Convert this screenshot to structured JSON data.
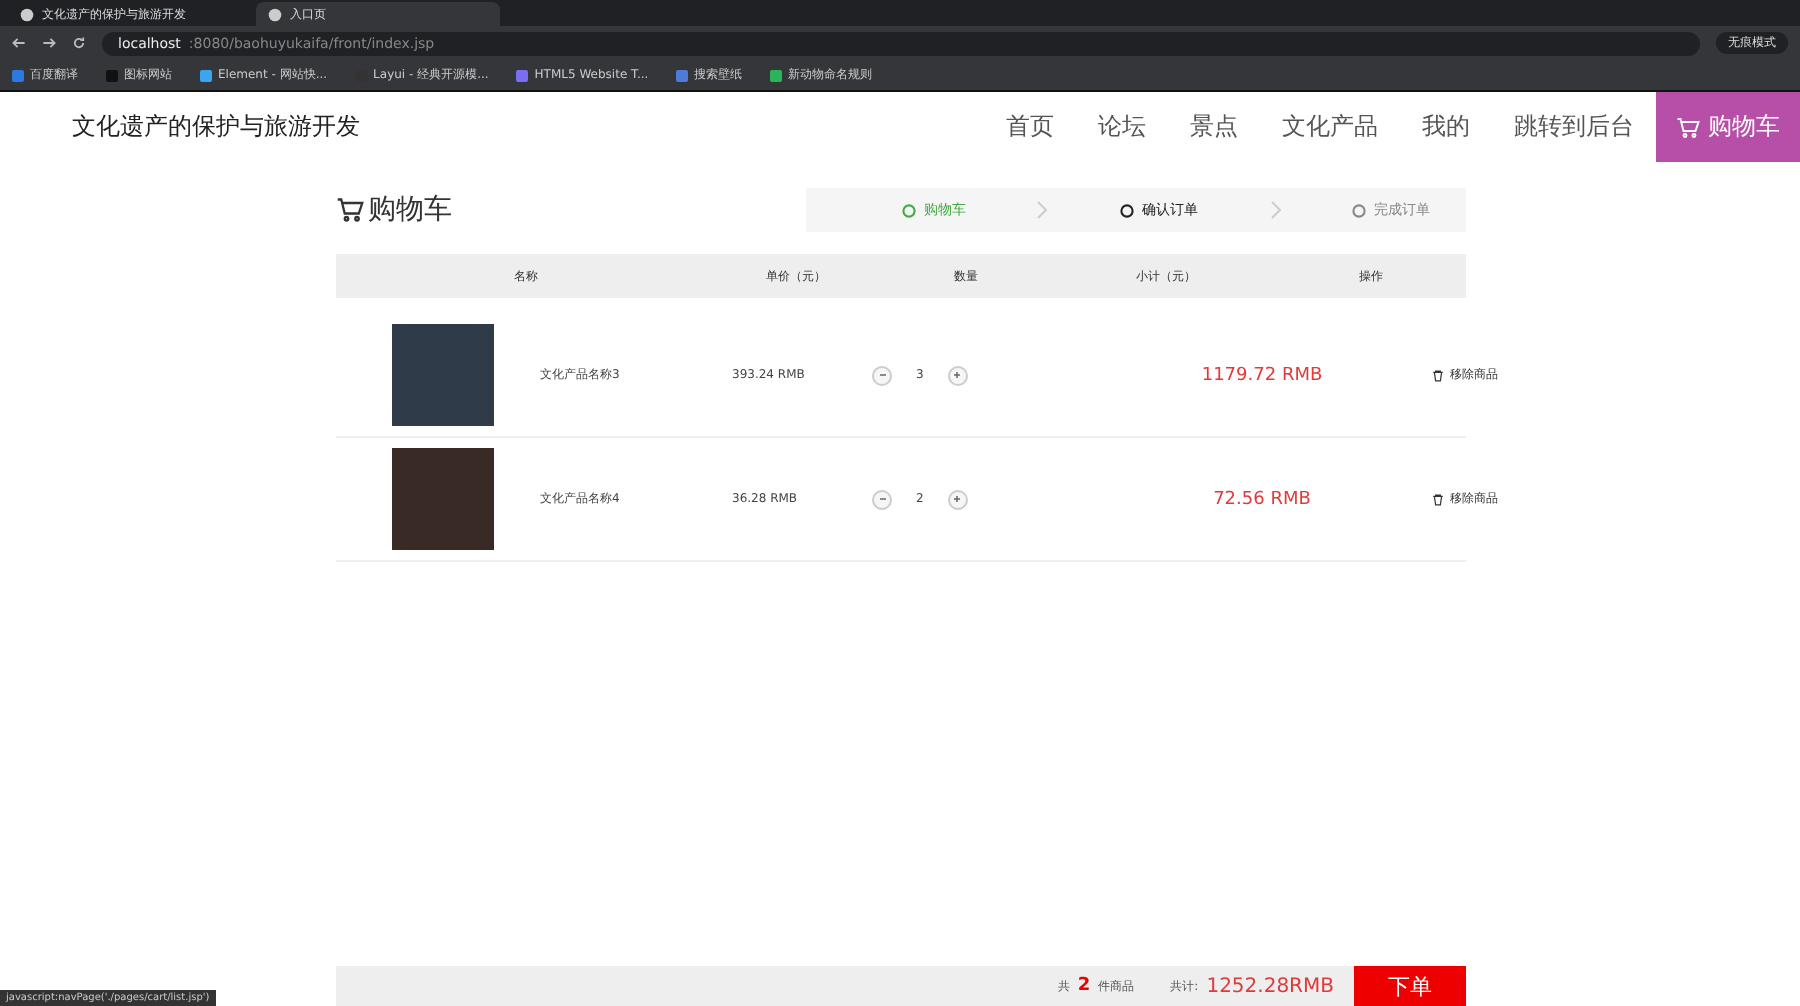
{
  "browser": {
    "tabs": [
      {
        "title": "文化遗产的保护与旅游开发",
        "selected": false
      },
      {
        "title": "入口页",
        "selected": true
      }
    ],
    "url": {
      "host": "localhost",
      "path": ":8080/baohuyukaifa/front/index.jsp"
    },
    "bookmarks": [
      "百度翻译",
      "图标网站",
      "Element - 网站快...",
      "Layui - 经典开源模...",
      "HTML5 Website T...",
      "搜索壁纸",
      "新动物命名规则"
    ],
    "profile": "无痕模式"
  },
  "header": {
    "title": "文化遗产的保护与旅游开发",
    "nav": [
      {
        "label": "首页",
        "selected": false
      },
      {
        "label": "论坛",
        "selected": false
      },
      {
        "label": "景点",
        "selected": false
      },
      {
        "label": "文化产品",
        "selected": false
      },
      {
        "label": "我的",
        "selected": false
      },
      {
        "label": "跳转到后台",
        "selected": false
      },
      {
        "label": "购物车",
        "selected": true
      }
    ]
  },
  "cart": {
    "title": "购物车",
    "steps": [
      {
        "label": "购物车",
        "kind": "done"
      },
      {
        "label": "确认订单",
        "kind": "current"
      },
      {
        "label": "完成订单",
        "kind": "todo"
      }
    ],
    "columns": [
      "名称",
      "单价（元）",
      "数量",
      "小计（元）",
      "操作"
    ],
    "rows": [
      {
        "name": "文化产品名称3",
        "price": "393.24 RMB",
        "quantity": "3",
        "subtotal": "1179.72 RMB",
        "action": "移除商品"
      },
      {
        "name": "文化产品名称4",
        "price": "36.28 RMB",
        "quantity": "2",
        "subtotal": "72.56 RMB",
        "action": "移除商品"
      }
    ],
    "footer": {
      "count_prefix": "共",
      "count": "2",
      "count_suffix": "件商品",
      "total_label": "共计:",
      "total": "1252.28RMB",
      "submit": "下单"
    }
  },
  "status_link": "javascript:navPage('./pages/cart/list.jsp')"
}
